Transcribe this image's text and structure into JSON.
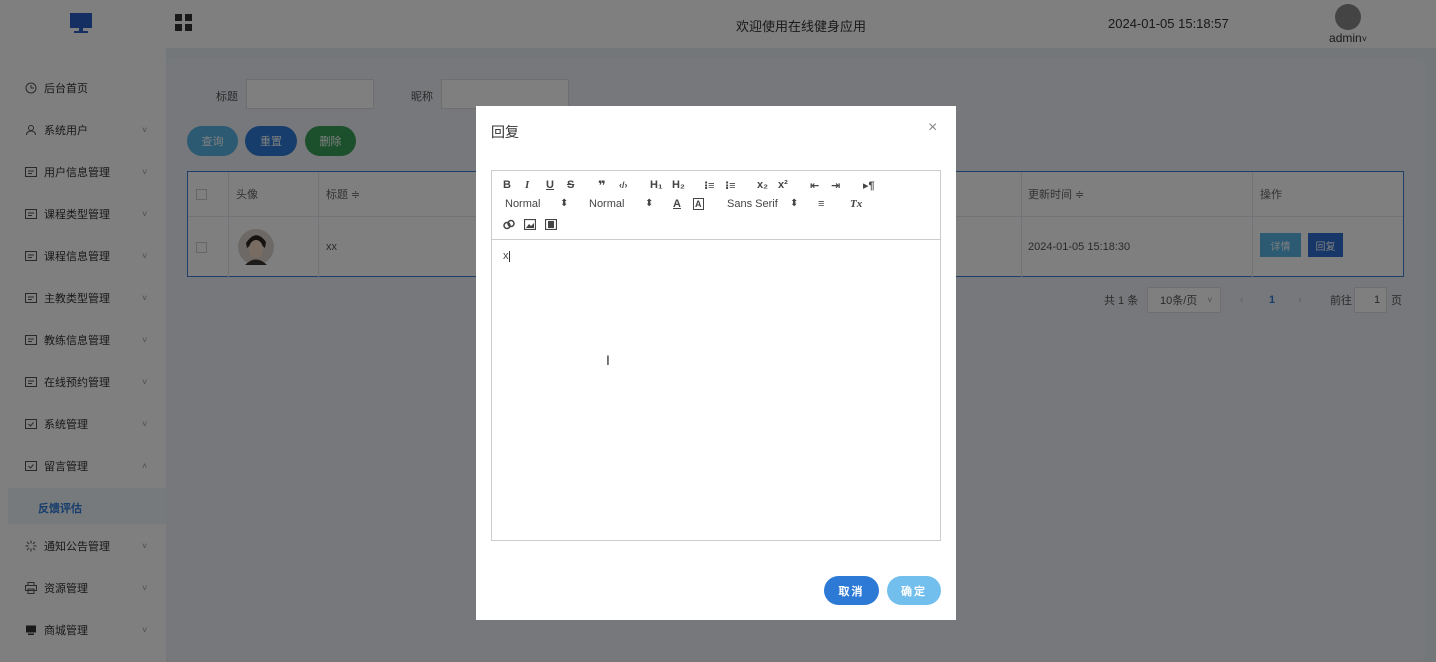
{
  "header": {
    "title": "欢迎使用在线健身应用",
    "datetime": "2024-01-05 15:18:57",
    "user": "admin",
    "user_caret": "˅"
  },
  "sidebar": {
    "items": [
      {
        "label": "后台首页",
        "icon": "clock-icon",
        "arrow": ""
      },
      {
        "label": "系统用户",
        "icon": "user-icon",
        "arrow": "˅"
      },
      {
        "label": "用户信息管理",
        "icon": "list-icon",
        "arrow": "˅"
      },
      {
        "label": "课程类型管理",
        "icon": "list-icon",
        "arrow": "˅"
      },
      {
        "label": "课程信息管理",
        "icon": "list-icon",
        "arrow": "˅"
      },
      {
        "label": "主教类型管理",
        "icon": "list-icon",
        "arrow": "˅"
      },
      {
        "label": "教练信息管理",
        "icon": "list-icon",
        "arrow": "˅"
      },
      {
        "label": "在线预约管理",
        "icon": "list-icon",
        "arrow": "˅"
      },
      {
        "label": "系统管理",
        "icon": "check-box-icon",
        "arrow": "˅"
      },
      {
        "label": "留言管理",
        "icon": "check-box-icon",
        "arrow": "˄"
      },
      {
        "label": "通知公告管理",
        "icon": "loading-icon",
        "arrow": "˅"
      },
      {
        "label": "资源管理",
        "icon": "printer-icon",
        "arrow": "˅"
      },
      {
        "label": "商城管理",
        "icon": "monitor-icon",
        "arrow": "˅"
      }
    ],
    "active_sub": "反馈评估"
  },
  "search": {
    "title_label": "标题",
    "nickname_label": "昵称",
    "title_value": "",
    "nickname_value": ""
  },
  "actions": {
    "query": "查询",
    "reset": "重置",
    "delete": "删除"
  },
  "table": {
    "headers": [
      "头像",
      "标题 ≑",
      "更新时间 ≑",
      "操作"
    ],
    "rows": [
      {
        "title": "xx",
        "updated": "2024-01-05 15:18:30",
        "detail_btn": "详情",
        "reply_btn": "回复"
      }
    ]
  },
  "pager": {
    "total": "共 1 条",
    "page_size": "10条/页",
    "current": "1",
    "goto_label": "前往",
    "goto_value": "1",
    "page_suffix": "页"
  },
  "dialog": {
    "title": "回复",
    "close": "×",
    "toolbar": {
      "bold": "B",
      "italic": "I",
      "underline": "U",
      "strike": "S",
      "quote": "❞",
      "code": "‹/›",
      "h1": "H₁",
      "h2": "H₂",
      "ordered": "⁝≡",
      "bullet": "⁝≡",
      "sub": "x₂",
      "sup": "x²",
      "outdent": "⇤",
      "indent": "⇥",
      "rtl": "▸¶",
      "size1": "Normal",
      "size2": "Normal",
      "font": "Sans Serif",
      "color": "A",
      "bg": "A",
      "align": "≡",
      "clean": "Tx",
      "updown": "⬍"
    },
    "content": "x",
    "cancel": "取消",
    "confirm": "确定"
  },
  "colors": {
    "primary": "#2d7ad6",
    "query_btn": "#5bb5e6",
    "reset_btn": "#2d7ad6",
    "delete_btn": "#38a05a",
    "detail_btn": "#5bb5e6",
    "reply_btn": "#2d6fcf",
    "confirm_btn": "#72bfee"
  }
}
